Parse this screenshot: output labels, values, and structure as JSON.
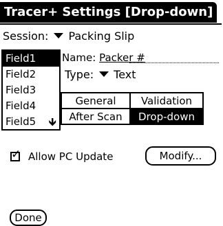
{
  "title": "Tracer+ Settings [Drop-down]",
  "session": {
    "label": "Session:",
    "value": "Packing Slip",
    "icon": "dropdown-triangle-icon"
  },
  "fields": {
    "items": [
      "Field1",
      "Field2",
      "Field3",
      "Field4",
      "Field5"
    ],
    "selected": "Field1",
    "scroll_icon": "scroll-down-arrow-icon",
    "scroll_glyph": "🡻"
  },
  "name": {
    "label": "Name:",
    "value": "Packer #"
  },
  "type": {
    "label": "Type:",
    "value": "Text",
    "icon": "dropdown-triangle-icon"
  },
  "tabs": {
    "row1": [
      "General",
      "Validation"
    ],
    "row2": [
      "After Scan",
      "Drop-down"
    ],
    "active": "Drop-down"
  },
  "allow_pc_update": {
    "label": "Allow PC Update",
    "checked": true,
    "check_glyph": "✓"
  },
  "buttons": {
    "modify": "Modify...",
    "done": "Done"
  }
}
